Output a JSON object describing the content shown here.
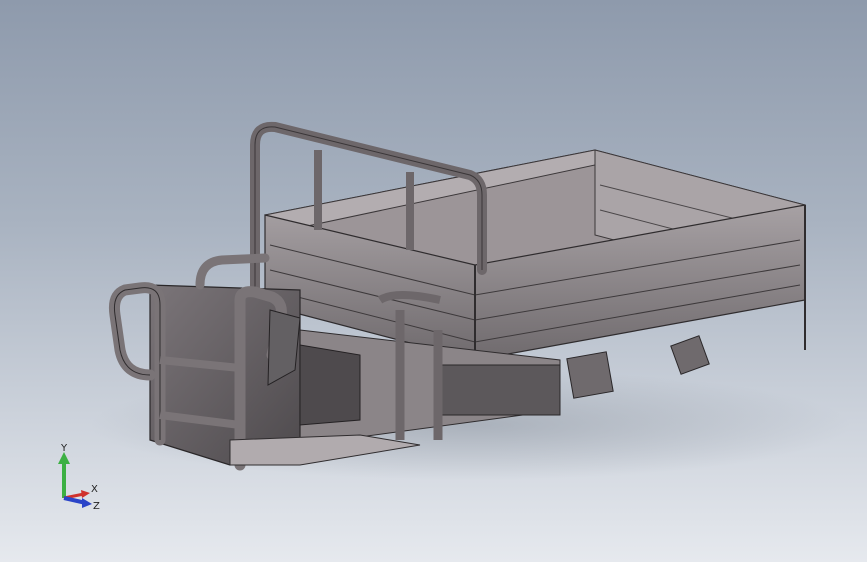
{
  "viewport": {
    "background_top": "#8e9aac",
    "background_bottom": "#e6e9ee",
    "model_color": "#8a8488"
  },
  "triad": {
    "y_label": "Y",
    "x_label": "X",
    "z_label": "Z",
    "y_color": "#3cb043",
    "x_color": "#d0312d",
    "z_color": "#2a44c8"
  }
}
